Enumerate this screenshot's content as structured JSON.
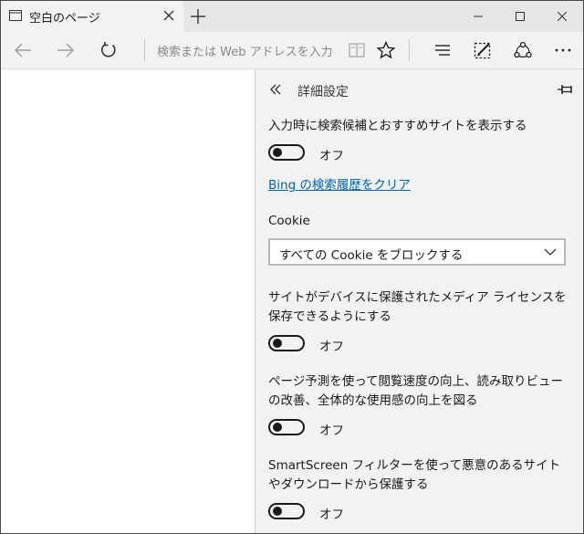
{
  "tab": {
    "title": "空白のページ"
  },
  "address_bar": {
    "placeholder": "検索または Web アドレスを入力"
  },
  "panel": {
    "title": "詳細設定",
    "settings": [
      {
        "label": "入力時に検索候補とおすすめサイトを表示する",
        "toggle": "オフ"
      },
      {
        "label": "サイトがデバイスに保護されたメディア ライセンスを保存できるようにする",
        "toggle": "オフ"
      },
      {
        "label": "ページ予測を使って閲覧速度の向上、読み取りビューの改善、全体的な使用感の向上を図る",
        "toggle": "オフ"
      },
      {
        "label": "SmartScreen フィルターを使って悪意のあるサイトやダウンロードから保護する",
        "toggle": "オフ"
      }
    ],
    "clear_history_link": "Bing の検索履歴をクリア",
    "cookie": {
      "label": "Cookie",
      "selected": "すべての Cookie をブロックする"
    }
  },
  "colors": {
    "link": "#0063b1",
    "panel_bg": "#f2f2f2",
    "tabbar_bg": "#e6e6e6"
  }
}
